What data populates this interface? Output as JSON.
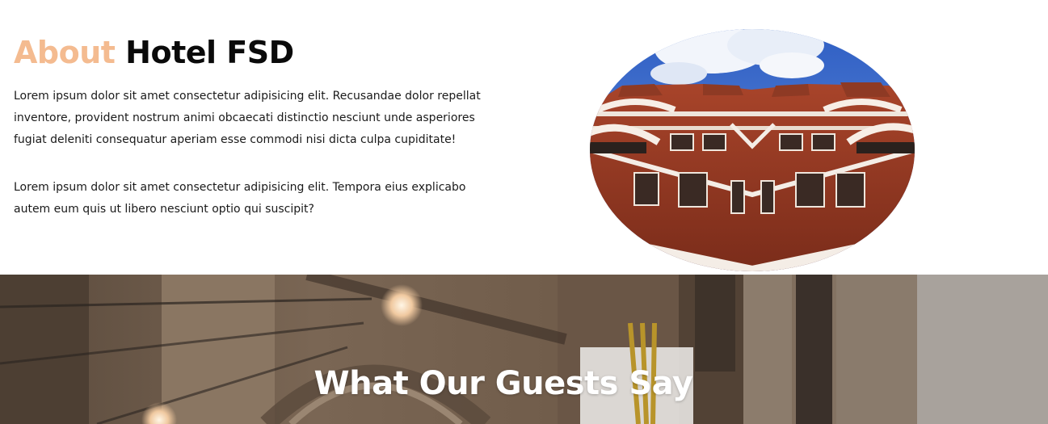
{
  "about": {
    "title_accent": "About",
    "title_rest": "Hotel FSD",
    "paragraph_1": "Lorem ipsum dolor sit amet consectetur adipisicing elit. Recusandae dolor repellat inventore, provident nostrum animi obcaecati distinctio nesciunt unde asperiores fugiat deleniti consequatur aperiam esse commodi nisi dicta culpa cupiditate!",
    "paragraph_2": "Lorem ipsum dolor sit amet consectetur adipisicing elit. Tempora eius explicabo autem eum quis ut libero nesciunt optio qui suscipit?",
    "accent_color": "#f4bb90"
  },
  "testimonials": {
    "title": "What Our Guests Say"
  }
}
